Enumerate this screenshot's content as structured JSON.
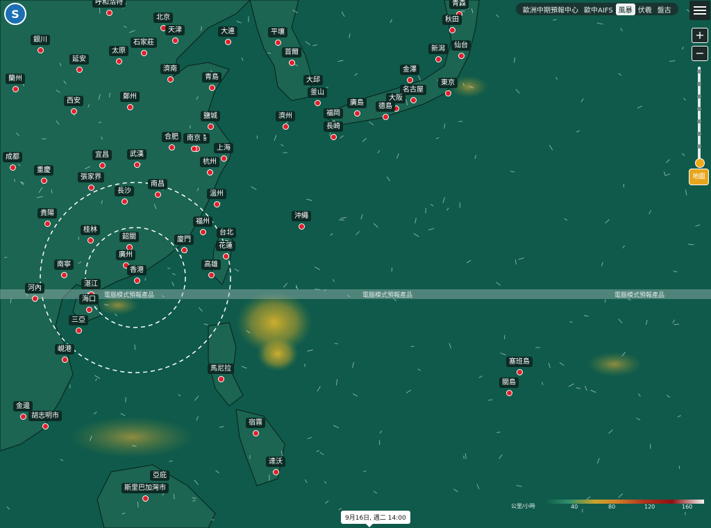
{
  "header": {
    "models": [
      {
        "label": "歐洲中期預報中心",
        "active": false
      },
      {
        "label": "歐中AIFS",
        "active": false
      },
      {
        "label": "風暴",
        "active": true
      },
      {
        "label": "伏羲",
        "active": false
      },
      {
        "label": "盤古",
        "active": false
      }
    ]
  },
  "controls": {
    "zoom_in": "+",
    "zoom_out": "−",
    "map_button": "地圖"
  },
  "banner_text": "電腦模式預報產品",
  "timestamp": "9月16日, 週二 14:00",
  "legend": {
    "unit": "公里/小時",
    "ticks": [
      "40",
      "80",
      "120",
      "160"
    ]
  },
  "colors": {
    "sea": "#0f5a4b",
    "land": "#1d6250",
    "wind_yellow": "#c9a22a",
    "city_dot": "#e0202a"
  },
  "cities": [
    {
      "name": "呼和浩特"
    },
    {
      "name": "北京"
    },
    {
      "name": "天津"
    },
    {
      "name": "石家莊"
    },
    {
      "name": "太原"
    },
    {
      "name": "銀川"
    },
    {
      "name": "延安"
    },
    {
      "name": "濟南"
    },
    {
      "name": "蘭州"
    },
    {
      "name": "西安"
    },
    {
      "name": "鄭州"
    },
    {
      "name": "大連"
    },
    {
      "name": "平壤"
    },
    {
      "name": "首爾"
    },
    {
      "name": "青島"
    },
    {
      "name": "青森"
    },
    {
      "name": "秋田"
    },
    {
      "name": "仙台"
    },
    {
      "name": "新潟"
    },
    {
      "name": "金澤"
    },
    {
      "name": "東京"
    },
    {
      "name": "名古屋"
    },
    {
      "name": "大阪"
    },
    {
      "name": "德島"
    },
    {
      "name": "廣島"
    },
    {
      "name": "大邱"
    },
    {
      "name": "釜山"
    },
    {
      "name": "福岡"
    },
    {
      "name": "濟州"
    },
    {
      "name": "長崎"
    },
    {
      "name": "鹽城"
    },
    {
      "name": "鹿兒島"
    },
    {
      "name": "合肥"
    },
    {
      "name": "南京"
    },
    {
      "name": "上海"
    },
    {
      "name": "宜昌"
    },
    {
      "name": "武漢"
    },
    {
      "name": "杭州"
    },
    {
      "name": "成都"
    },
    {
      "name": "重慶"
    },
    {
      "name": "張家界"
    },
    {
      "name": "南昌"
    },
    {
      "name": "長沙"
    },
    {
      "name": "溫州"
    },
    {
      "name": "貴陽"
    },
    {
      "name": "沖繩"
    },
    {
      "name": "福州"
    },
    {
      "name": "桂林"
    },
    {
      "name": "台北"
    },
    {
      "name": "韶關"
    },
    {
      "name": "廈門"
    },
    {
      "name": "花蓮"
    },
    {
      "name": "廣州"
    },
    {
      "name": "南寧"
    },
    {
      "name": "香港"
    },
    {
      "name": "高雄"
    },
    {
      "name": "河內"
    },
    {
      "name": "湛江"
    },
    {
      "name": "海口"
    },
    {
      "name": "三亞"
    },
    {
      "name": "峴港"
    },
    {
      "name": "馬尼拉"
    },
    {
      "name": "塞班島"
    },
    {
      "name": "關島"
    },
    {
      "name": "金邊"
    },
    {
      "name": "胡志明市"
    },
    {
      "name": "宿霧"
    },
    {
      "name": "達沃"
    },
    {
      "name": "亞庇"
    },
    {
      "name": "斯里巴加灣市"
    }
  ]
}
